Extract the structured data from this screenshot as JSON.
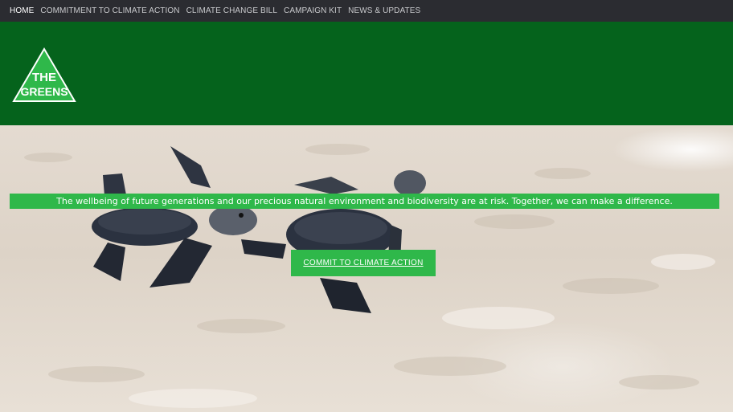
{
  "nav": {
    "items": [
      {
        "label": "HOME",
        "active": true
      },
      {
        "label": "COMMITMENT TO CLIMATE ACTION",
        "active": false
      },
      {
        "label": "CLIMATE CHANGE BILL",
        "active": false
      },
      {
        "label": "CAMPAIGN KIT",
        "active": false
      },
      {
        "label": "NEWS & UPDATES",
        "active": false
      }
    ]
  },
  "header": {
    "logo_text_line1": "THE",
    "logo_text_line2": "GREENS",
    "background_color": "#05631c"
  },
  "hero": {
    "image": "baby-sea-turtles-on-sand",
    "tagline": "The wellbeing of future generations and our precious natural environment and biodiversity are at risk. Together, we can make a difference.",
    "cta_label": "COMMIT TO CLIMATE ACTION",
    "accent_color": "#2fb84a"
  }
}
